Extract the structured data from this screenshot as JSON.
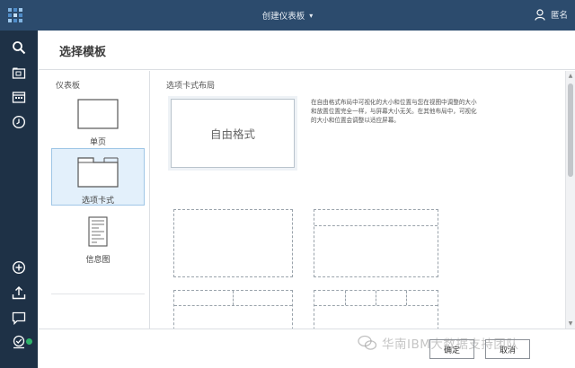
{
  "topbar": {
    "title": "创建仪表板",
    "user_label": "匿名",
    "icons": [
      "app-logo-icon",
      "chevron-down-icon",
      "user-icon"
    ]
  },
  "sidebar": {
    "icons": [
      "search-icon",
      "folder-icon",
      "calendar-icon",
      "clock-icon",
      "add-icon",
      "upload-icon",
      "chat-icon",
      "badge-icon"
    ]
  },
  "dialog": {
    "title": "选择模板",
    "left_heading": "仪表板",
    "templates": [
      {
        "label": "单页",
        "selected": false
      },
      {
        "label": "选项卡式",
        "selected": true
      },
      {
        "label": "信息图",
        "selected": false
      }
    ],
    "main_heading": "选项卡式布局",
    "freeform_label": "自由格式",
    "freeform_description": "在自由格式布局中可视化的大小和位置与您在视图中调整的大小和放置位置完全一样，与屏幕大小无关。在其他布局中，可视化的大小和位置会调整以适应屏幕。",
    "ok_label": "确定",
    "cancel_label": "取消"
  },
  "watermark": {
    "text": "华南IBM大数据支持团队"
  },
  "colors": {
    "topbar": "#2c4b6d",
    "sidebar": "#1e3146",
    "selected_bg": "#e3f0fb",
    "status_dot": "#2fb36b"
  }
}
